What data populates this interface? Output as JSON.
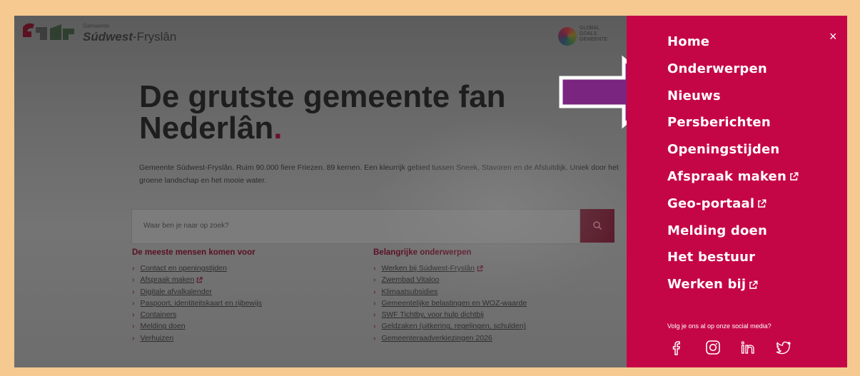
{
  "header": {
    "logo_small": "Gemeente",
    "logo_name_bold": "Súdwest",
    "logo_name_rest": "-Fryslân",
    "global_goals": [
      "GLOBAL",
      "GOALS",
      "GEMEENTE"
    ]
  },
  "hero": {
    "title_line1": "De grutste gemeente fan",
    "title_line2": "Nederlân",
    "title_dot": ".",
    "intro": "Gemeente Súdwest-Fryslân. Ruim 90.000 fiere Friezen. 89 kernen. Een kleurrijk gebied tussen Sneek, Stavoren en de Afsluitdijk. Uniek door het groene landschap en het mooie water."
  },
  "search": {
    "placeholder": "Waar ben je naar op zoek?"
  },
  "left_column": {
    "heading": "De meeste mensen komen voor",
    "items": [
      {
        "label": "Contact en openingstijden",
        "external": false
      },
      {
        "label": "Afspraak maken",
        "external": true
      },
      {
        "label": "Digitale afvalkalender",
        "external": false
      },
      {
        "label": "Paspoort, identiteitskaart en rijbewijs",
        "external": false
      },
      {
        "label": "Containers",
        "external": false
      },
      {
        "label": "Melding doen",
        "external": false
      },
      {
        "label": "Verhuizen",
        "external": false
      }
    ]
  },
  "right_column": {
    "heading": "Belangrijke onderwerpen",
    "items": [
      {
        "label": "Werken bij Súdwest-Fryslân",
        "external": true
      },
      {
        "label": "Zwembad Vitaloo",
        "external": false
      },
      {
        "label": "Klimaatsubsidies",
        "external": false
      },
      {
        "label": "Gemeentelijke belastingen en WOZ-waarde",
        "external": false
      },
      {
        "label": "SWF Tichtby, voor hulp dichtbij",
        "external": false
      },
      {
        "label": "Geldzaken (uitkering, regelingen, schulden)",
        "external": false
      },
      {
        "label": "Gemeenteraadverkiezingen 2026",
        "external": false
      }
    ]
  },
  "menu": {
    "close_label": "×",
    "items": [
      {
        "label": "Home",
        "external": false
      },
      {
        "label": "Onderwerpen",
        "external": false
      },
      {
        "label": "Nieuws",
        "external": false
      },
      {
        "label": "Persberichten",
        "external": false
      },
      {
        "label": "Openingstijden",
        "external": false
      },
      {
        "label": "Afspraak maken",
        "external": true
      },
      {
        "label": "Geo-portaal",
        "external": true
      },
      {
        "label": "Melding doen",
        "external": false
      },
      {
        "label": "Het bestuur",
        "external": false
      },
      {
        "label": "Werken bij",
        "external": true
      }
    ],
    "social_text": "Volg je ons al op onze social media?",
    "social_icons": [
      "facebook-icon",
      "instagram-icon",
      "linkedin-icon",
      "twitter-icon"
    ]
  },
  "colors": {
    "panel": "#c50646",
    "arrow_fill": "#7a2680",
    "accent_dim": "#5a0f25"
  }
}
